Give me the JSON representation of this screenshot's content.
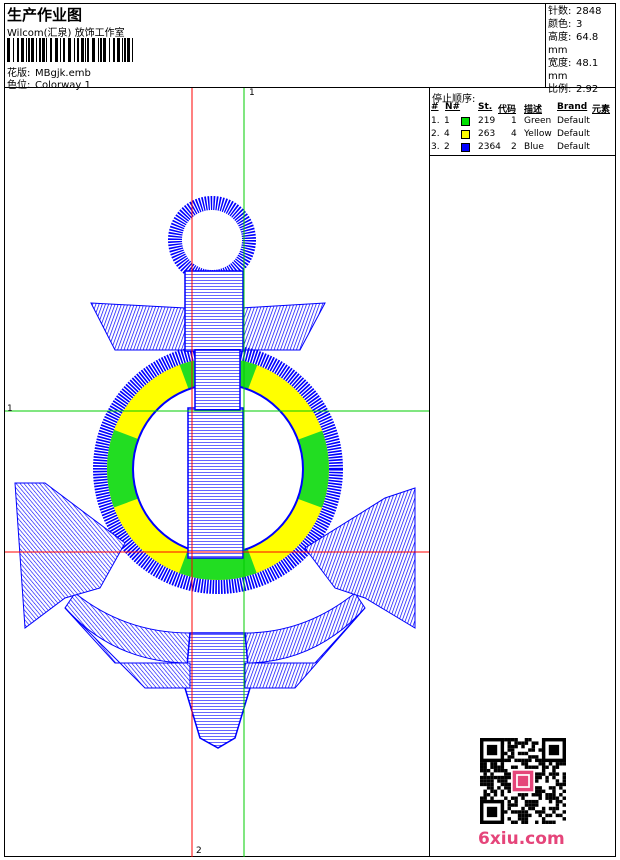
{
  "header": {
    "title": "生产作业图",
    "company": "Wilcom(汇泉) 放饰工作室",
    "design_label": "花版:",
    "design_value": "MBgjk.emb",
    "colorway_label": "色位:",
    "colorway_value": "Colorway 1"
  },
  "stats": {
    "stitches_label": "针数:",
    "stitches_value": "2848",
    "colors_label": "颜色:",
    "colors_value": "3",
    "height_label": "高度:",
    "height_value": "64.8 mm",
    "width_label": "宽度:",
    "width_value": "48.1 mm",
    "ratio_label": "比例:",
    "ratio_value": "2.92"
  },
  "stop_sequence": {
    "title": "停止顺序:",
    "columns": [
      "#",
      "N#",
      "St.",
      "代码",
      "描述",
      "Brand",
      "元素"
    ],
    "rows": [
      {
        "idx": "1.",
        "n": "1",
        "color": "#00e000",
        "st": "219",
        "code": "1",
        "desc": "Green",
        "brand": "Default"
      },
      {
        "idx": "2.",
        "n": "4",
        "color": "#ffff00",
        "st": "263",
        "code": "4",
        "desc": "Yellow",
        "brand": "Default"
      },
      {
        "idx": "3.",
        "n": "2",
        "color": "#0000ff",
        "st": "2364",
        "code": "2",
        "desc": "Blue",
        "brand": "Default"
      }
    ]
  },
  "canvas": {
    "guide_top_label": "1",
    "guide_left_label": "1",
    "guide_bottom_label": "2",
    "stitch_blue": "#0000ff",
    "stitch_green": "#22dd22",
    "stitch_yellow": "#ffff00",
    "guide_green": "#00cc00",
    "guide_red": "#ff0000"
  },
  "watermark": "6xiu.com"
}
